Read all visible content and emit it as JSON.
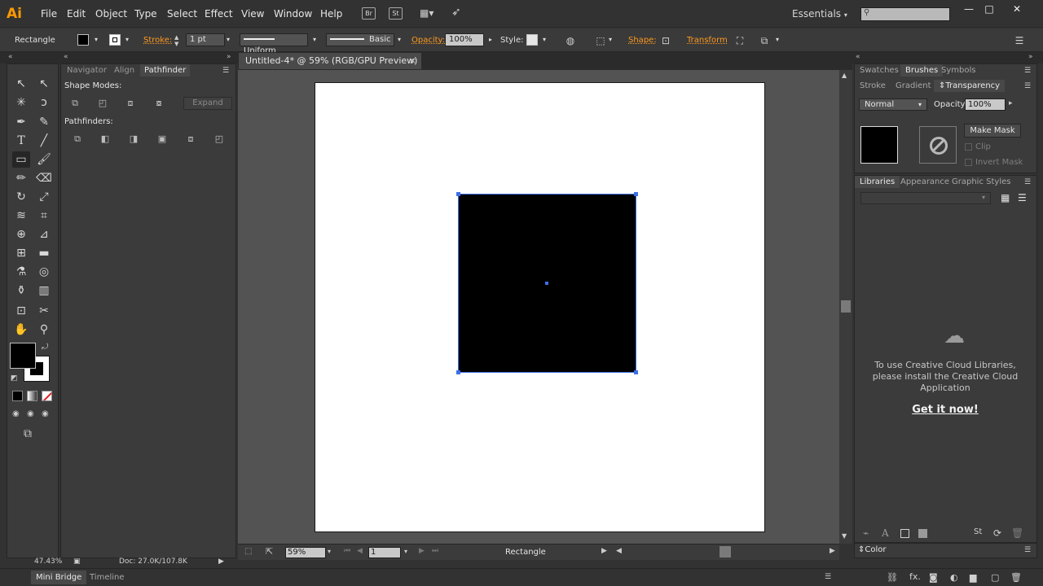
{
  "app": {
    "logo": "Ai",
    "workspace": "Essentials"
  },
  "menu": [
    "File",
    "Edit",
    "Object",
    "Type",
    "Select",
    "Effect",
    "View",
    "Window",
    "Help"
  ],
  "menu_icons": {
    "bridge": "Br",
    "stock": "St"
  },
  "window_controls": {
    "minimize": "—",
    "maximize": "□",
    "close": "✕"
  },
  "control_bar": {
    "object_type": "Rectangle",
    "stroke_label": "Stroke:",
    "stroke_weight": "1 pt",
    "profile": "Uniform",
    "brush": "Basic",
    "opacity_label": "Opacity:",
    "opacity_value": "100%",
    "style_label": "Style:",
    "shape_label": "Shape:",
    "transform_label": "Transform"
  },
  "pathfinder_panel": {
    "tabs": [
      "Navigator",
      "Align",
      "Pathfinder"
    ],
    "shape_modes_label": "Shape Modes:",
    "pathfinders_label": "Pathfinders:",
    "expand_label": "Expand"
  },
  "document": {
    "tab_title": "Untitled-4* @ 59% (RGB/GPU Preview)",
    "tab_close": "×",
    "zoom": "59%",
    "artboard_number": "1",
    "status_text": "Rectangle"
  },
  "right_panels": {
    "top_tabs": [
      "Swatches",
      "Brushes",
      "Symbols"
    ],
    "second_tabs": [
      "Stroke",
      "Gradient",
      "Transparency"
    ],
    "blend_mode": "Normal",
    "opacity_label": "Opacity:",
    "opacity_value": "100%",
    "make_mask_label": "Make Mask",
    "clip_label": "Clip",
    "invert_mask_label": "Invert Mask",
    "library_tabs": [
      "Libraries",
      "Appearance",
      "Graphic Styles"
    ],
    "library_message": "To use Creative Cloud Libraries, please install the Creative Cloud Application",
    "library_link": "Get it now!",
    "color_panel_label": "Color"
  },
  "bottom": {
    "zoom_info": "47.43%",
    "doc_info": "Doc: 27.0K/107.8K",
    "tabs": [
      "Mini Bridge",
      "Timeline"
    ]
  },
  "icons": [
    "selection-tool-icon",
    "direct-selection-tool-icon",
    "magic-wand-icon",
    "lasso-icon",
    "pen-icon",
    "curvature-icon",
    "type-icon",
    "line-icon",
    "rectangle-icon",
    "paintbrush-icon",
    "pencil-icon",
    "eraser-icon",
    "rotate-icon",
    "scale-icon",
    "width-icon",
    "free-transform-icon",
    "shape-builder-icon",
    "perspective-icon",
    "mesh-icon",
    "gradient-icon",
    "eyedropper-icon",
    "blend-icon",
    "symbol-sprayer-icon",
    "graph-icon",
    "artboard-icon",
    "slice-icon",
    "hand-icon",
    "zoom-icon"
  ]
}
